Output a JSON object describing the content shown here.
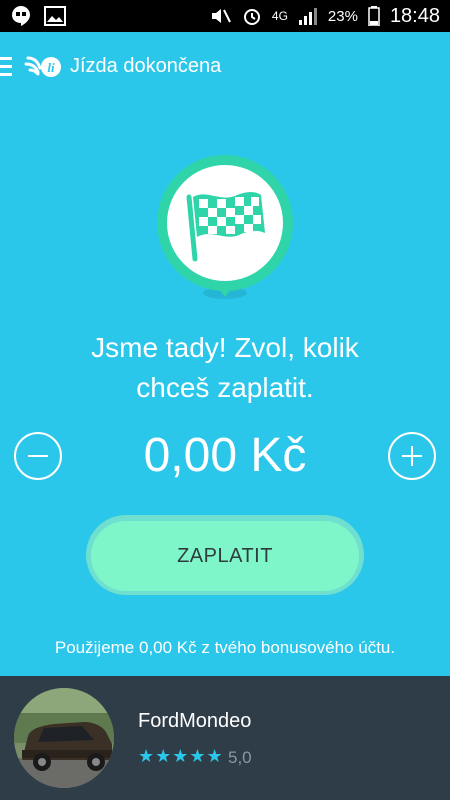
{
  "status_bar": {
    "network": "4G",
    "battery": "23%",
    "time": "18:48"
  },
  "header": {
    "title": "Jízda dokončena"
  },
  "main": {
    "message_line1": "Jsme tady! Zvol, kolik",
    "message_line2": "chceš zaplatit.",
    "amount": "0,00 Kč",
    "pay_button": "ZAPLATIT",
    "bonus_note": "Použijeme 0,00 Kč z tvého bonusového účtu."
  },
  "driver": {
    "car": "FordMondeo",
    "stars": "★★★★★",
    "rating": "5,0"
  },
  "colors": {
    "background": "#2bc7ea",
    "button": "#7ff6c9",
    "flag_ring": "#2fd5a8",
    "driver_bar": "#2f3d48"
  }
}
